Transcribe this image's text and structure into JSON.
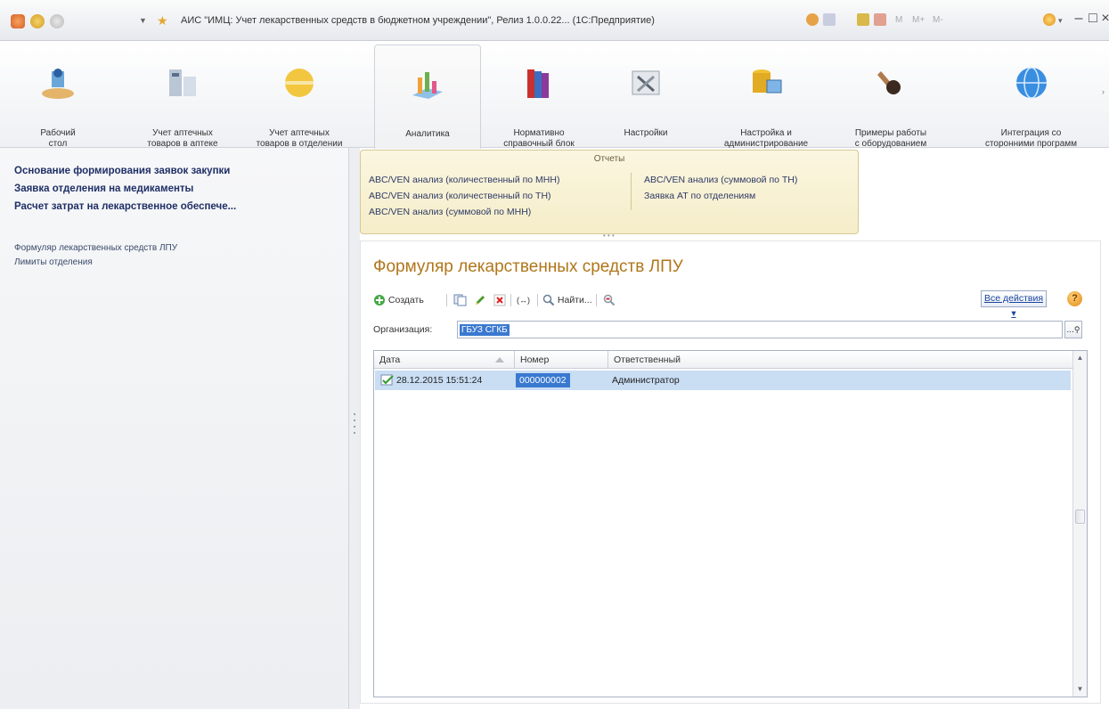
{
  "window": {
    "title": "АИС \"ИМЦ: Учет лекарственных средств в бюджетном учреждении\", Релиз 1.0.0.22...  (1С:Предприятие)"
  },
  "sections": [
    {
      "label": "Рабочий\nстол",
      "icon": "desktop-icon"
    },
    {
      "label": "Учет аптечных\nтоваров в аптеке",
      "icon": "pharmacy-icon"
    },
    {
      "label": "Учет аптечных\nтоваров в отделении",
      "icon": "pill-icon"
    },
    {
      "label": "Аналитика",
      "icon": "analytics-icon"
    },
    {
      "label": "Нормативно\nсправочный блок",
      "icon": "books-icon"
    },
    {
      "label": "Настройки",
      "icon": "tools-icon"
    },
    {
      "label": "Настройка и\nадминистрирование",
      "icon": "database-icon"
    },
    {
      "label": "Примеры работы\nс оборудованием",
      "icon": "scanner-icon"
    },
    {
      "label": "Интеграция со\nсторонними программ",
      "icon": "globe-icon"
    }
  ],
  "navigation": {
    "bold_items": [
      "Основание формирования заявок закупки",
      "Заявка отделения на медикаменты",
      "Расчет затрат на лекарственное обеспече..."
    ],
    "items": [
      "Формуляр лекарственных средств ЛПУ",
      "Лимиты отделения"
    ]
  },
  "reports": {
    "header": "Отчеты",
    "left": [
      "ABC/VEN анализ (количественный по МНН)",
      "ABC/VEN анализ (количественный по ТН)",
      "ABC/VEN анализ (суммовой по МНН)"
    ],
    "right": [
      "ABC/VEN анализ (суммовой по ТН)",
      "Заявка АТ по отделениям"
    ]
  },
  "form": {
    "title": "Формуляр лекарственных средств ЛПУ",
    "toolbar": {
      "create": "Создать",
      "find": "Найти...",
      "all_actions": "Все действия",
      "help": "?"
    },
    "organization": {
      "label": "Организация:",
      "value": "ГБУЗ СГКБ",
      "select_button": "...",
      "search_glyph": "🔍"
    },
    "table": {
      "columns": [
        "Дата",
        "Номер",
        "Ответственный"
      ],
      "rows": [
        {
          "date": "28.12.2015 15:51:24",
          "number": "000000002",
          "responsible": "Администратор"
        }
      ]
    }
  },
  "colors": {
    "form_title": "#b0761a",
    "nav_bold": "#1f2f66",
    "selection": "#3a79d0",
    "row_highlight": "#c9ddf3"
  }
}
